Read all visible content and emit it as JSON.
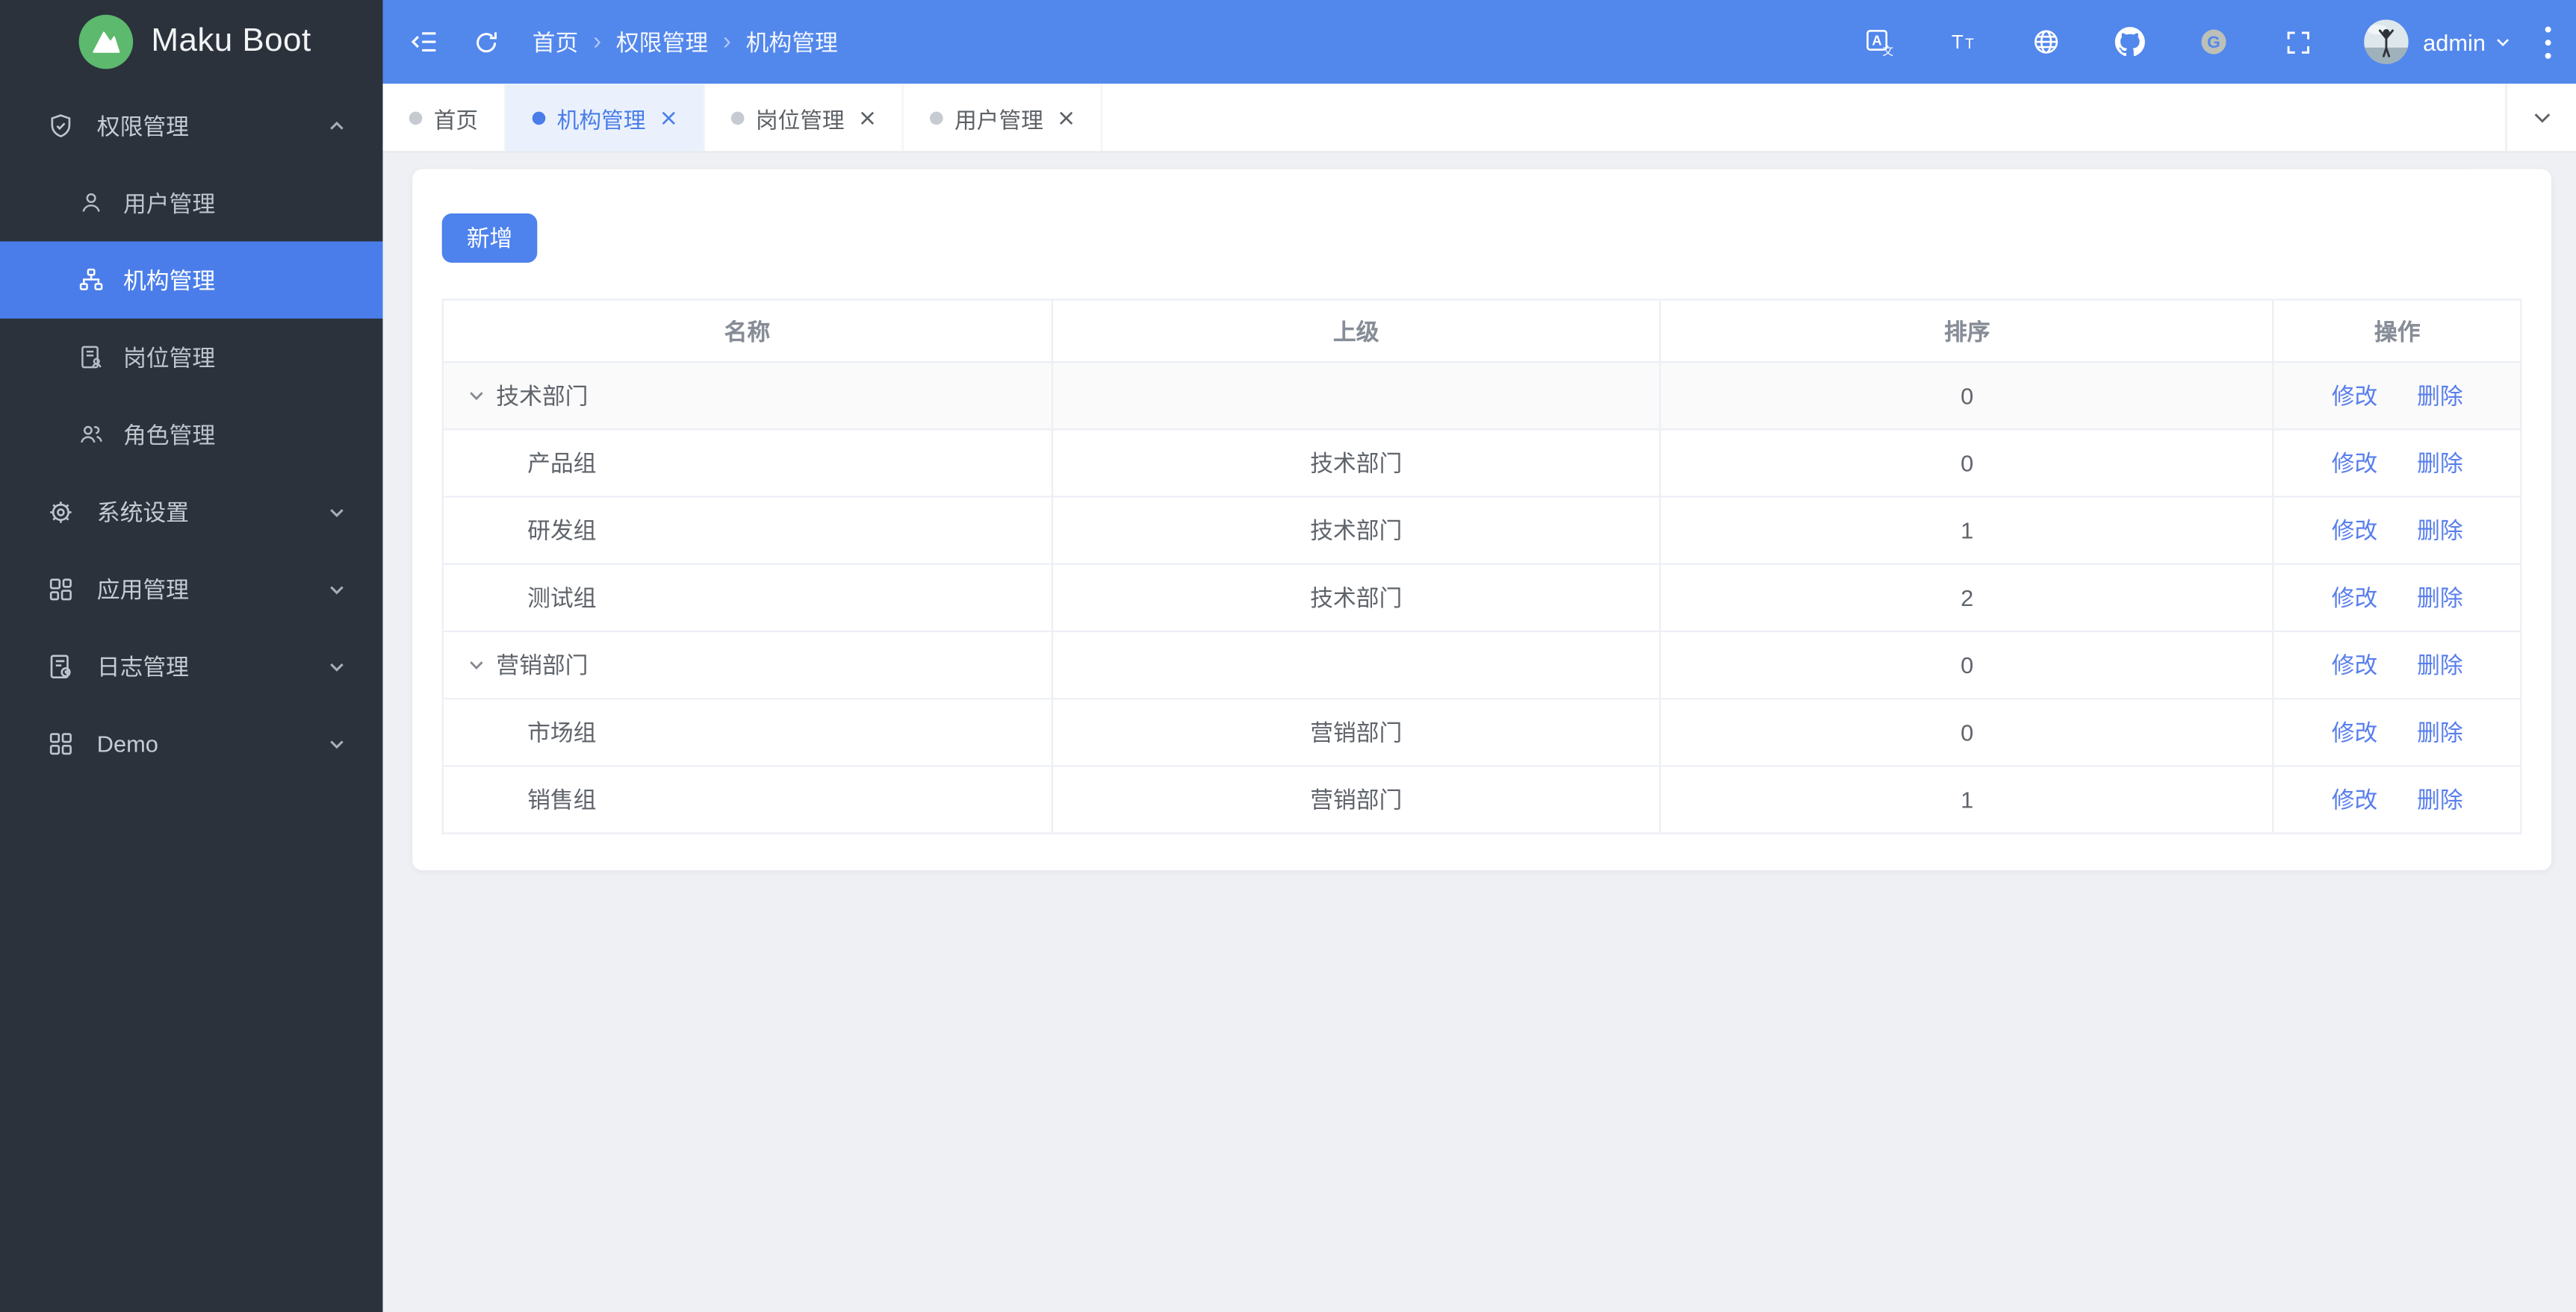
{
  "app": {
    "title": "Maku Boot"
  },
  "colors": {
    "header_bg": "#5287ec",
    "sidebar_bg": "#2b323c",
    "accent_blue": "#4a7dea",
    "active_tab_bg": "#eaf1fc",
    "content_bg": "#eef0f4",
    "link_blue": "#587eec",
    "logo_green": "#5cb96d",
    "button_blue": "#4e82ec"
  },
  "sidebar": {
    "logo_text": "Maku Boot",
    "menu": [
      {
        "label": "权限管理",
        "icon": "shield-check-icon",
        "state": "expanded",
        "children": [
          {
            "label": "用户管理",
            "icon": "user-icon",
            "active": false
          },
          {
            "label": "机构管理",
            "icon": "org-chart-icon",
            "active": true
          },
          {
            "label": "岗位管理",
            "icon": "post-doc-icon",
            "active": false
          },
          {
            "label": "角色管理",
            "icon": "roles-icon",
            "active": false
          }
        ]
      },
      {
        "label": "系统设置",
        "icon": "gear-icon",
        "state": "collapsed"
      },
      {
        "label": "应用管理",
        "icon": "apps-grid-icon",
        "state": "collapsed"
      },
      {
        "label": "日志管理",
        "icon": "log-doc-icon",
        "state": "collapsed"
      },
      {
        "label": "Demo",
        "icon": "demo-grid-icon",
        "state": "collapsed"
      }
    ]
  },
  "header": {
    "breadcrumb": [
      "首页",
      "权限管理",
      "机构管理"
    ],
    "breadcrumb_separator": "›",
    "username": "admin",
    "icons": [
      "translate-icon",
      "font-size-icon",
      "globe-icon",
      "github-icon",
      "gitee-icon",
      "fullscreen-icon"
    ]
  },
  "tabbar": {
    "tabs": [
      {
        "label": "首页",
        "active": false,
        "closable": false
      },
      {
        "label": "机构管理",
        "active": true,
        "closable": true
      },
      {
        "label": "岗位管理",
        "active": false,
        "closable": true
      },
      {
        "label": "用户管理",
        "active": false,
        "closable": true
      }
    ]
  },
  "toolbar": {
    "add_label": "新增"
  },
  "table": {
    "columns": [
      "名称",
      "上级",
      "排序",
      "操作"
    ],
    "action_labels": {
      "edit": "修改",
      "delete": "删除"
    },
    "rows": [
      {
        "name": "技术部门",
        "parent": "",
        "sort": "0",
        "expandable": true,
        "level": 0,
        "highlight": true
      },
      {
        "name": "产品组",
        "parent": "技术部门",
        "sort": "0",
        "expandable": false,
        "level": 1,
        "highlight": false
      },
      {
        "name": "研发组",
        "parent": "技术部门",
        "sort": "1",
        "expandable": false,
        "level": 1,
        "highlight": false
      },
      {
        "name": "测试组",
        "parent": "技术部门",
        "sort": "2",
        "expandable": false,
        "level": 1,
        "highlight": false
      },
      {
        "name": "营销部门",
        "parent": "",
        "sort": "0",
        "expandable": true,
        "level": 0,
        "highlight": false
      },
      {
        "name": "市场组",
        "parent": "营销部门",
        "sort": "0",
        "expandable": false,
        "level": 1,
        "highlight": false
      },
      {
        "name": "销售组",
        "parent": "营销部门",
        "sort": "1",
        "expandable": false,
        "level": 1,
        "highlight": false
      }
    ]
  }
}
